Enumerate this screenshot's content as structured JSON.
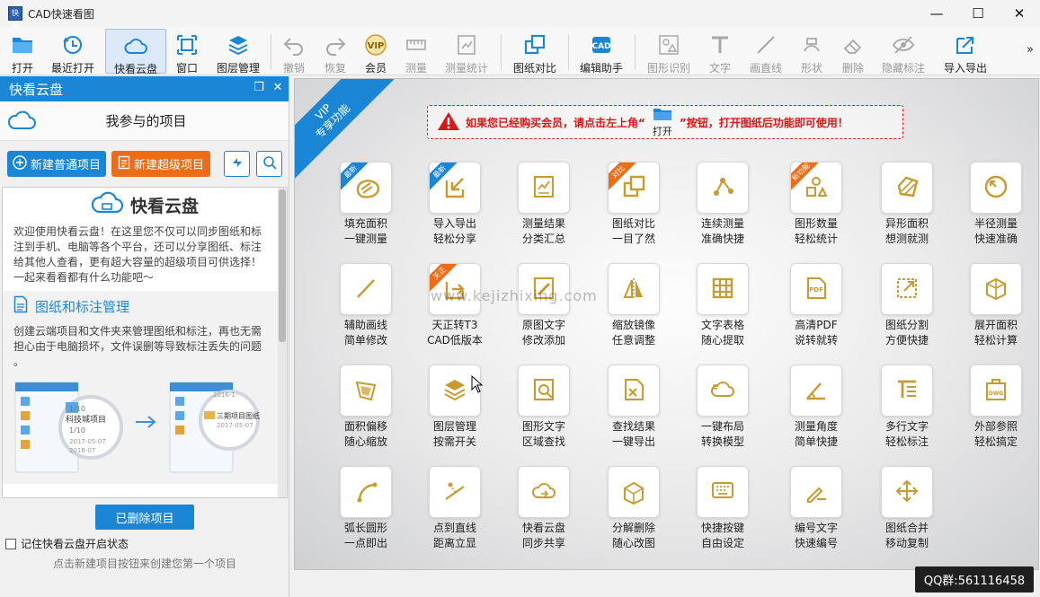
{
  "window": {
    "title": "CAD快速看图",
    "app_icon_text": "快看",
    "minimize": "—",
    "maximize": "☐",
    "close": "✕"
  },
  "toolbar": [
    {
      "id": "open",
      "label": "打开",
      "icon": "folder-icon",
      "enabled": true
    },
    {
      "id": "recent",
      "label": "最近打开",
      "icon": "clock-icon",
      "enabled": true
    },
    {
      "id": "cloud",
      "label": "快看云盘",
      "icon": "cloud-icon",
      "enabled": true,
      "active": true
    },
    {
      "id": "window",
      "label": "窗口",
      "icon": "window-icon",
      "enabled": true
    },
    {
      "id": "layers",
      "label": "图层管理",
      "icon": "layers-icon",
      "enabled": true
    },
    {
      "id": "undo",
      "label": "撤销",
      "icon": "undo-icon",
      "enabled": false
    },
    {
      "id": "redo",
      "label": "恢复",
      "icon": "redo-icon",
      "enabled": false
    },
    {
      "id": "vip",
      "label": "会员",
      "icon": "vip-icon",
      "enabled": true,
      "vip": true
    },
    {
      "id": "measure",
      "label": "测量",
      "icon": "ruler-icon",
      "enabled": false
    },
    {
      "id": "measure_stats",
      "label": "测量统计",
      "icon": "measure-stats-icon",
      "enabled": false
    },
    {
      "id": "compare",
      "label": "图纸对比",
      "icon": "compare-icon",
      "enabled": true
    },
    {
      "id": "edit_helper",
      "label": "编辑助手",
      "icon": "edit-helper-icon",
      "enabled": true
    },
    {
      "id": "shape_recog",
      "label": "图形识别",
      "icon": "shape-recognize-icon",
      "enabled": false
    },
    {
      "id": "text",
      "label": "文字",
      "icon": "text-icon",
      "enabled": false
    },
    {
      "id": "line",
      "label": "画直线",
      "icon": "line-icon",
      "enabled": false
    },
    {
      "id": "shape",
      "label": "形状",
      "icon": "shape-icon",
      "enabled": false
    },
    {
      "id": "delete",
      "label": "删除",
      "icon": "eraser-icon",
      "enabled": false
    },
    {
      "id": "hide",
      "label": "隐藏标注",
      "icon": "eye-hide-icon",
      "enabled": false
    },
    {
      "id": "import_export",
      "label": "导入导出",
      "icon": "export-icon",
      "enabled": true
    }
  ],
  "toolbar_overflow": "»",
  "cloud_panel": {
    "title": "快看云盘",
    "project_title": "我参与的项目",
    "new_normal_project": "新建普通项目",
    "new_super_project": "新建超级项目",
    "intro_title": "快看云盘",
    "intro_text": "欢迎使用快看云盘！在这里您不仅可以同步图纸和标注到手机、电脑等各个平台，还可以分享图纸、标注给其他人查看，更有超大容量的超级项目可供选择！一起来看看都有什么功能吧～",
    "section_title": "图纸和标注管理",
    "section_text": "创建云端项目和文件夹来管理图纸和标注，再也无需担心由于电脑损坏，文件误删等导致标注丢失的问题 。",
    "illus_left_items": [
      "1/10",
      "科技城项目",
      "1/10",
      "2017-05-07",
      "2016-07"
    ],
    "illus_right_items": [
      "2016-1",
      "三期项目图纸",
      "2017-05-07"
    ],
    "deleted_projects": "已删除项目",
    "remember_label": "记住快看云盘开启状态",
    "hint": "点击新建项目按钮来创建您第一个项目"
  },
  "vip_panel": {
    "ribbon_line1": "VIP",
    "ribbon_line2": "专享功能",
    "notice_before": "如果您已经购买会员，请点击左上角“",
    "notice_open": "打开",
    "notice_after": "”按钮，打开图纸后功能即可使用！",
    "watermark": "www.kejizhixing.com",
    "features": [
      {
        "l1": "填充面积",
        "l2": "一键测量",
        "icon": "fill-area-icon",
        "tag": "最新",
        "tag_color": "blue"
      },
      {
        "l1": "导入导出",
        "l2": "轻松分享",
        "icon": "import-export-icon",
        "tag": "最新",
        "tag_color": "blue"
      },
      {
        "l1": "测量结果",
        "l2": "分类汇总",
        "icon": "measure-summary-icon"
      },
      {
        "l1": "图纸对比",
        "l2": "一目了然",
        "icon": "drawing-compare-icon",
        "tag": "对比",
        "tag_color": "orange"
      },
      {
        "l1": "连续测量",
        "l2": "准确快捷",
        "icon": "continuous-measure-icon"
      },
      {
        "l1": "图形数量",
        "l2": "轻松统计",
        "icon": "shape-count-icon",
        "tag": "新功能",
        "tag_color": "orange"
      },
      {
        "l1": "异形面积",
        "l2": "想测就测",
        "icon": "irregular-area-icon"
      },
      {
        "l1": "半径测量",
        "l2": "快速准确",
        "icon": "radius-measure-icon"
      },
      {
        "l1": "辅助画线",
        "l2": "简单修改",
        "icon": "aux-line-icon"
      },
      {
        "l1": "天正转T3",
        "l2": "CAD低版本",
        "icon": "tangent-convert-icon",
        "tag": "天正",
        "tag_color": "orange"
      },
      {
        "l1": "原图文字",
        "l2": "修改添加",
        "icon": "edit-text-icon"
      },
      {
        "l1": "缩放镜像",
        "l2": "任意调整",
        "icon": "mirror-icon"
      },
      {
        "l1": "文字表格",
        "l2": "随心提取",
        "icon": "table-extract-icon"
      },
      {
        "l1": "高清PDF",
        "l2": "说转就转",
        "icon": "pdf-icon"
      },
      {
        "l1": "图纸分割",
        "l2": "方便快捷",
        "icon": "split-icon"
      },
      {
        "l1": "展开面积",
        "l2": "轻松计算",
        "icon": "unfold-area-icon"
      },
      {
        "l1": "面积偏移",
        "l2": "随心缩放",
        "icon": "area-offset-icon"
      },
      {
        "l1": "图层管理",
        "l2": "按需开关",
        "icon": "layer-manage-icon"
      },
      {
        "l1": "图形文字",
        "l2": "区域查找",
        "icon": "region-search-icon"
      },
      {
        "l1": "查找结果",
        "l2": "一键导出",
        "icon": "search-export-icon"
      },
      {
        "l1": "一键布局",
        "l2": "转换模型",
        "icon": "layout-convert-icon"
      },
      {
        "l1": "测量角度",
        "l2": "简单快捷",
        "icon": "angle-measure-icon"
      },
      {
        "l1": "多行文字",
        "l2": "轻松标注",
        "icon": "multiline-text-icon"
      },
      {
        "l1": "外部参照",
        "l2": "轻松搞定",
        "icon": "xref-icon"
      },
      {
        "l1": "弧长圆形",
        "l2": "一点即出",
        "icon": "arc-length-icon"
      },
      {
        "l1": "点到直线",
        "l2": "距离立显",
        "icon": "point-line-icon"
      },
      {
        "l1": "快看云盘",
        "l2": "同步共享",
        "icon": "cloud-sync-icon"
      },
      {
        "l1": "分解删除",
        "l2": "随心改图",
        "icon": "explode-icon"
      },
      {
        "l1": "快捷按键",
        "l2": "自由设定",
        "icon": "hotkey-icon"
      },
      {
        "l1": "编号文字",
        "l2": "快速编号",
        "icon": "numbering-icon"
      },
      {
        "l1": "图纸合并",
        "l2": "移动复制",
        "icon": "merge-move-icon"
      }
    ]
  },
  "qq_badge": "QQ群:561116458",
  "colors": {
    "accent_blue": "#1c86d6",
    "accent_orange": "#ef6c16",
    "gold_icon": "#c99a2e",
    "warning_red": "#d81818"
  }
}
